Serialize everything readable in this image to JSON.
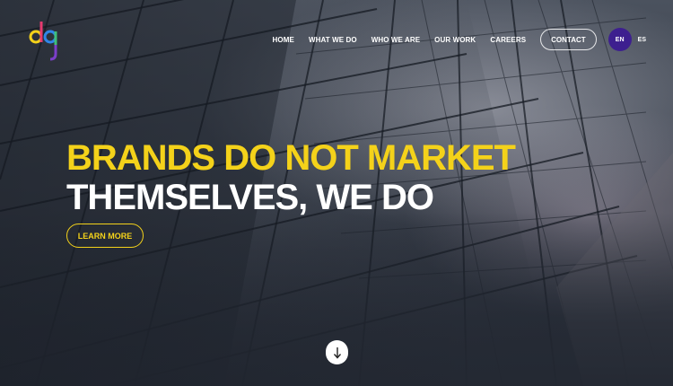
{
  "nav": {
    "items": [
      "HOME",
      "WHAT WE DO",
      "WHO WE ARE",
      "OUR WORK",
      "CAREERS"
    ],
    "contact_label": "CONTACT",
    "lang_active": "EN",
    "lang_other": "ES"
  },
  "hero": {
    "headline_line1": "BRANDS DO NOT MARKET",
    "headline_line2": "THEMSELVES, WE DO",
    "cta_label": "LEARN MORE"
  },
  "icons": {
    "logo": "dg-logo",
    "scroll": "arrow-down-icon"
  },
  "colors": {
    "accent": "#f4d21a",
    "lang_active_bg": "#3d1f8f",
    "text": "#ffffff"
  }
}
